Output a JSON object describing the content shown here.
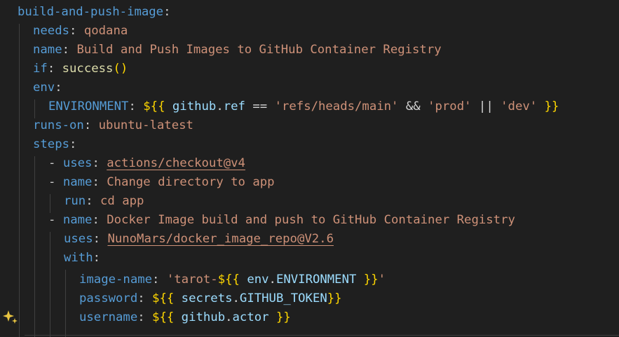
{
  "editor": {
    "lines": {
      "l1": {
        "key": "build-and-push-image",
        "colon": ":"
      },
      "l2": {
        "key": "needs",
        "colon": ":",
        "value": "qodana"
      },
      "l3": {
        "key": "name",
        "colon": ":",
        "value": "Build and Push Images to GitHub Container Registry"
      },
      "l4": {
        "key": "if",
        "colon": ":",
        "func": "success",
        "parens": "()"
      },
      "l5": {
        "key": "env",
        "colon": ":"
      },
      "l6": {
        "key": "ENVIRONMENT",
        "colon": ":",
        "dollar": "$",
        "open": "{{",
        "v1": "github",
        "dot": ".",
        "v2": "ref",
        "eq": "==",
        "s1": "'refs/heads/main'",
        "and": "&&",
        "s2": "'prod'",
        "or": "||",
        "s3": "'dev'",
        "close": "}}"
      },
      "l7": {
        "key": "runs-on",
        "colon": ":",
        "value": "ubuntu-latest"
      },
      "l8": {
        "key": "steps",
        "colon": ":"
      },
      "l9": {
        "dash": "-",
        "key": "uses",
        "colon": ":",
        "value": "actions/checkout@v4"
      },
      "l10": {
        "dash": "-",
        "key": "name",
        "colon": ":",
        "value": "Change directory to app"
      },
      "l11": {
        "key": "run",
        "colon": ":",
        "value": "cd app"
      },
      "l12": {
        "dash": "-",
        "key": "name",
        "colon": ":",
        "value": "Docker Image build and push to GitHub Container Registry"
      },
      "l13": {
        "key": "uses",
        "colon": ":",
        "value": "NunoMars/docker_image_repo@V2.6"
      },
      "l14": {
        "key": "with",
        "colon": ":"
      },
      "l15": {
        "key": "image-name",
        "colon": ":",
        "s_pre": "'tarot-",
        "dollar": "$",
        "open": "{{",
        "v1": "env",
        "dot": ".",
        "v2": "ENVIRONMENT",
        "close": "}}",
        "s_post": "'"
      },
      "l16": {
        "key": "password",
        "colon": ":",
        "dollar": "$",
        "open": "{{",
        "v1": "secrets",
        "dot": ".",
        "v2": "GITHUB_TOKEN",
        "close": "}}"
      },
      "l17": {
        "key": "username",
        "colon": ":",
        "dollar": "$",
        "open": "{{",
        "v1": "github",
        "dot": ".",
        "v2": "actor",
        "close": "}}"
      }
    }
  },
  "colors": {
    "background": "#1f1f1f",
    "yaml_key": "#569cd6",
    "string": "#ce9178",
    "function": "#dcdcaa",
    "expression_brace": "#ffd700",
    "variable": "#9cdcfe",
    "sparkle": "#e8c441"
  },
  "icons": {
    "sparkle": "sparkle-icon"
  }
}
